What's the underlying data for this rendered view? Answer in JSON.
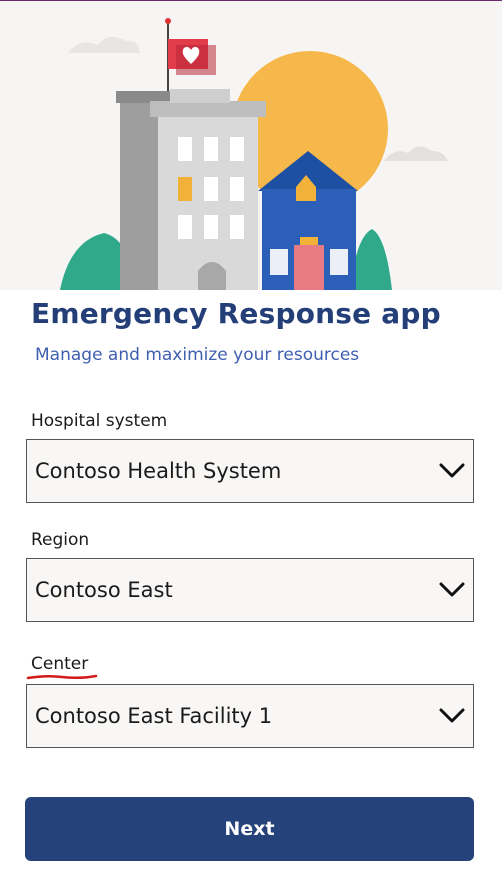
{
  "header": {
    "title": "Emergency Response app",
    "subtitle": "Manage and maximize your resources"
  },
  "hero": {
    "illustration": "hospital-buildings-illustration",
    "flag_icon": "heart-icon"
  },
  "form": {
    "hospital_system": {
      "label": "Hospital system",
      "value": "Contoso Health System"
    },
    "region": {
      "label": "Region",
      "value": "Contoso East"
    },
    "center": {
      "label": "Center",
      "value": "Contoso East Facility 1"
    }
  },
  "actions": {
    "next_label": "Next"
  },
  "colors": {
    "title": "#243f78",
    "subtitle": "#3f5fb0",
    "button": "#26427a",
    "annotation": "#d11a1a"
  }
}
